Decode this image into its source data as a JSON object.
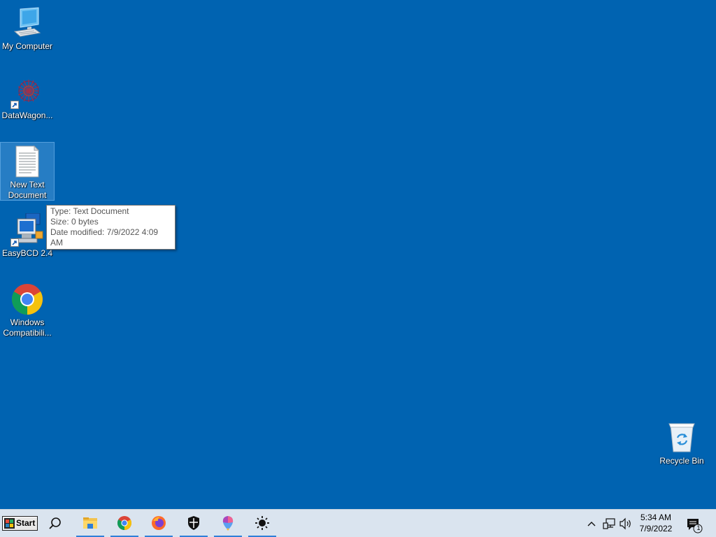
{
  "desktop": {
    "icons": [
      {
        "label": "My Computer"
      },
      {
        "label": "DataWagon..."
      },
      {
        "label": "New Text Document"
      },
      {
        "label": "EasyBCD 2.4"
      },
      {
        "label": "Windows Compatibili..."
      }
    ],
    "recycle_bin": {
      "label": "Recycle Bin"
    },
    "tooltip": {
      "type": "Type: Text Document",
      "size": "Size: 0 bytes",
      "modified": "Date modified: 7/9/2022 4:09 AM"
    },
    "colors": {
      "background": "#0063b1",
      "taskbar": "#dae4ef",
      "accent": "#2f7fd8"
    }
  },
  "taskbar": {
    "start_label": "Start",
    "pinned": [
      {
        "icon": "file-explorer-icon"
      },
      {
        "icon": "chrome-icon"
      },
      {
        "icon": "firefox-icon"
      },
      {
        "icon": "security-shield-icon"
      },
      {
        "icon": "paint-icon"
      },
      {
        "icon": "brightness-icon"
      }
    ],
    "tray": {
      "time": "5:34 AM",
      "date": "7/9/2022",
      "notification_count": "1"
    }
  }
}
